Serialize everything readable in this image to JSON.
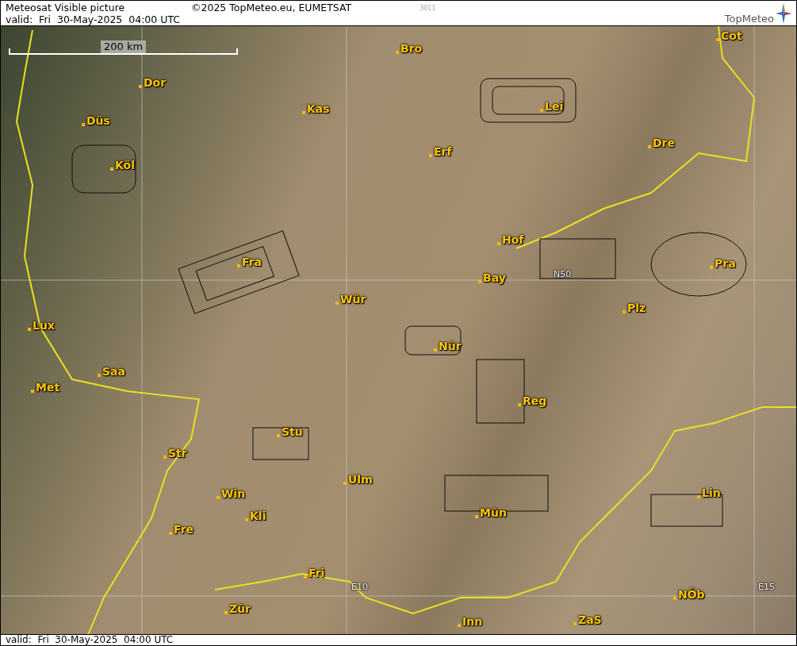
{
  "header": {
    "title": "Meteosat Visible picture",
    "copyright": "©2025 TopMeteo.eu, EUMETSAT",
    "code": "3011",
    "valid": "valid:  Fri  30-May-2025  04:00 UTC"
  },
  "logo": {
    "text": "TopMeteo"
  },
  "map": {
    "scale": "200 km",
    "grid_labels": [
      "N50",
      "E10",
      "E15"
    ],
    "cities": [
      {
        "label": "Bro"
      },
      {
        "label": "Cot"
      },
      {
        "label": "Dor"
      },
      {
        "label": "Kas"
      },
      {
        "label": "Lei"
      },
      {
        "label": "Düs"
      },
      {
        "label": "Erf"
      },
      {
        "label": "Dre"
      },
      {
        "label": "Köl"
      },
      {
        "label": "Hof"
      },
      {
        "label": "Fra"
      },
      {
        "label": "Pra"
      },
      {
        "label": "Bay"
      },
      {
        "label": "Wür"
      },
      {
        "label": "Plz"
      },
      {
        "label": "Lux"
      },
      {
        "label": "Nür"
      },
      {
        "label": "Saa"
      },
      {
        "label": "Met"
      },
      {
        "label": "Reg"
      },
      {
        "label": "Stu"
      },
      {
        "label": "Str"
      },
      {
        "label": "Ulm"
      },
      {
        "label": "Win"
      },
      {
        "label": "Lin"
      },
      {
        "label": "Kli"
      },
      {
        "label": "Mün"
      },
      {
        "label": "Fre"
      },
      {
        "label": "Fri"
      },
      {
        "label": "Zür"
      },
      {
        "label": "NÖb"
      },
      {
        "label": "Inn"
      },
      {
        "label": "ZaS"
      }
    ]
  },
  "footer": {
    "valid": "valid:  Fri  30-May-2025  04:00 UTC"
  }
}
